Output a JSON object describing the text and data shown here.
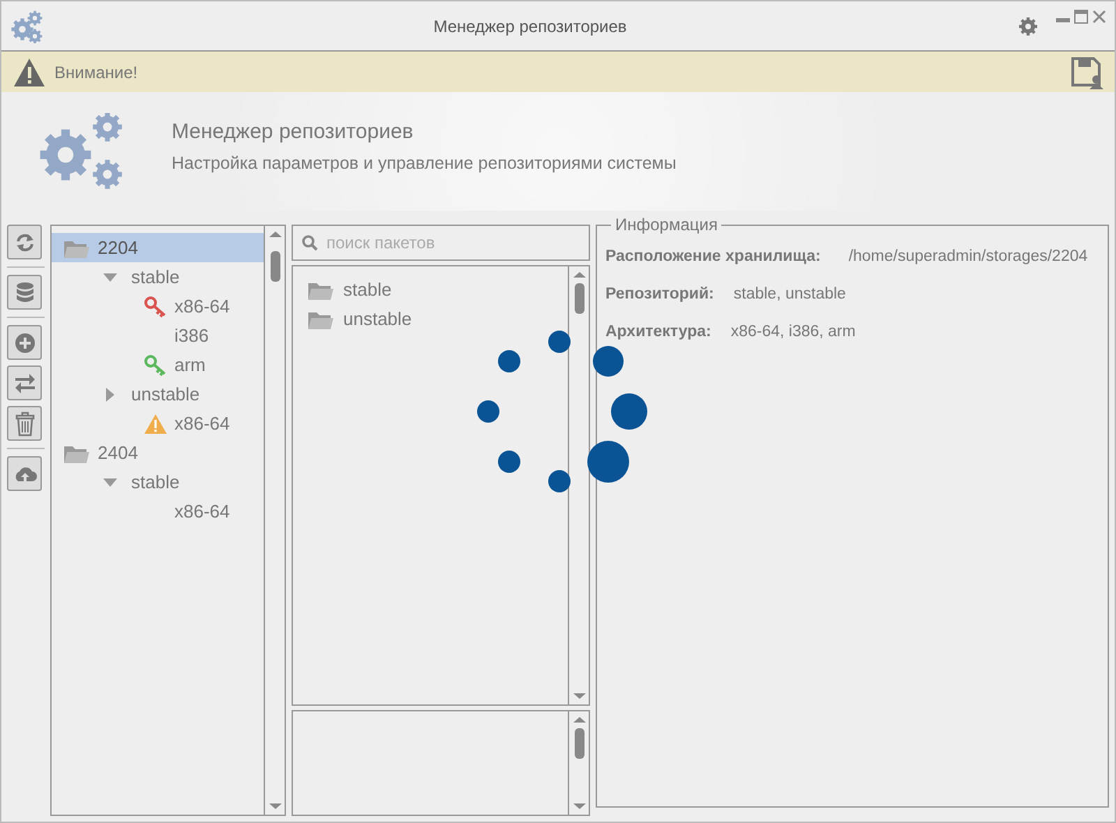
{
  "window": {
    "title": "Менеджер репозиториев"
  },
  "warning_bar": {
    "text": "Внимание!"
  },
  "header": {
    "title": "Менеджер репозиториев",
    "subtitle": "Настройка параметров и управление репозиториями системы"
  },
  "toolbar_groups": [
    [
      {
        "kind": "refresh"
      }
    ],
    [
      {
        "kind": "database"
      }
    ],
    [
      {
        "kind": "add"
      },
      {
        "kind": "swap"
      },
      {
        "kind": "delete"
      }
    ],
    [
      {
        "kind": "upload"
      }
    ]
  ],
  "tree": [
    {
      "label": "2204",
      "kind": "folder",
      "selected": true,
      "children": [
        {
          "label": "stable",
          "kind": "branch",
          "expanded": true,
          "selected": false,
          "children": [
            {
              "label": "x86-64",
              "kind": "key",
              "color": "#d9534f",
              "selected": false
            },
            {
              "label": "i386",
              "kind": "plain",
              "selected": false
            },
            {
              "label": "arm",
              "kind": "key",
              "color": "#5cb85c",
              "selected": false
            }
          ]
        },
        {
          "label": "unstable",
          "kind": "branch",
          "expanded": false,
          "selected": false,
          "children": [
            {
              "label": "x86-64",
              "kind": "warning",
              "selected": false
            }
          ]
        }
      ]
    },
    {
      "label": "2404",
      "kind": "folder",
      "selected": false,
      "children": [
        {
          "label": "stable",
          "kind": "branch",
          "expanded": true,
          "selected": false,
          "children": [
            {
              "label": "x86-64",
              "kind": "plain",
              "selected": false
            }
          ]
        }
      ]
    }
  ],
  "search": {
    "placeholder": "поиск пакетов"
  },
  "packages": [
    {
      "label": "stable"
    },
    {
      "label": "unstable"
    }
  ],
  "info": {
    "title": "Информация",
    "rows": [
      {
        "label": "Расположение хранилища:",
        "value": "/home/superadmin/storages/2204"
      },
      {
        "label": "Репозиторий:",
        "value": "stable, unstable"
      },
      {
        "label": "Архитектура:",
        "value": "x86-64, i386, arm"
      }
    ]
  }
}
